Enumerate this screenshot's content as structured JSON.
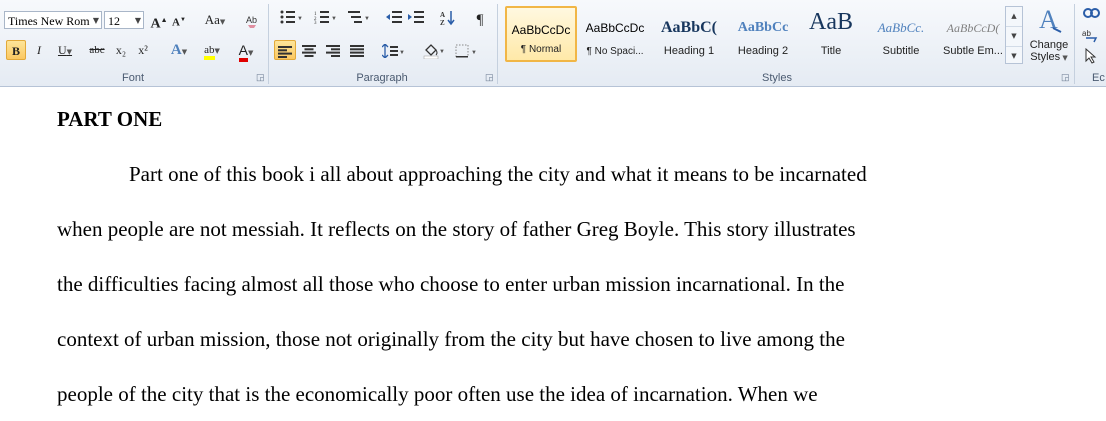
{
  "ribbon": {
    "font": {
      "name": "Times New Rom",
      "size": "12",
      "group_label": "Font",
      "grow_label": "A",
      "shrink_label": "A",
      "case_label": "Aa",
      "bold": "B",
      "italic": "I",
      "underline": "U",
      "strike": "abc",
      "subscript": "x₂",
      "superscript": "x²",
      "effects": "A",
      "highlight": "ab",
      "font_color": "A",
      "highlight_color": "#ffff00",
      "font_color_color": "#e00000"
    },
    "paragraph": {
      "group_label": "Paragraph",
      "pilcrow": "¶"
    },
    "styles": {
      "group_label": "Styles",
      "items": [
        {
          "sample": "AaBbCcDc",
          "name": "¶ Normal"
        },
        {
          "sample": "AaBbCcDc",
          "name": "¶ No Spaci..."
        },
        {
          "sample": "AaBbC(",
          "name": "Heading 1"
        },
        {
          "sample": "AaBbCc",
          "name": "Heading 2"
        },
        {
          "sample": "AaB",
          "name": "Title"
        },
        {
          "sample": "AaBbCc.",
          "name": "Subtitle"
        },
        {
          "sample": "AaBbCcD(",
          "name": "Subtle Em..."
        }
      ],
      "change_styles_line1": "Change",
      "change_styles_line2": "Styles",
      "heading_color": "#17365d",
      "accent_color": "#4f81bd"
    },
    "editing": {
      "group_label": "Ec"
    }
  },
  "document": {
    "heading": "PART ONE",
    "lines": [
      "Part one of this book i all about approaching the city and what it means to be incarnated",
      "when people are not messiah. It reflects on the story of father Greg Boyle. This story illustrates",
      "the difficulties facing almost all those who choose to enter urban mission incarnational. In the",
      "context of urban mission, those not originally from the city but have chosen to live among the",
      "people of the city that is the economically poor often use the idea of incarnation. When we"
    ]
  }
}
